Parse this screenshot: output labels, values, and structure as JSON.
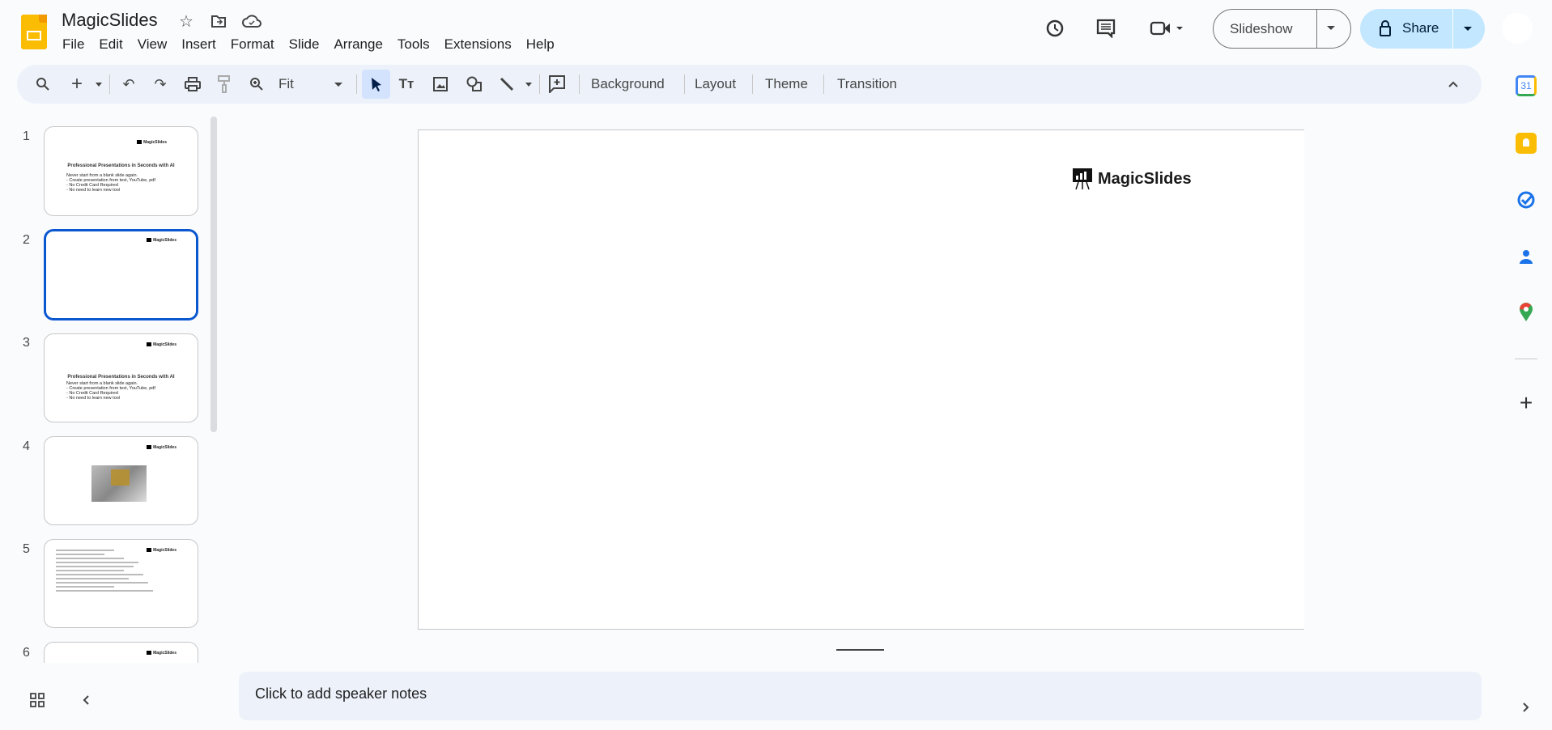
{
  "app": {
    "title": "MagicSlides",
    "menu": [
      "File",
      "Edit",
      "View",
      "Insert",
      "Format",
      "Slide",
      "Arrange",
      "Tools",
      "Extensions",
      "Help"
    ]
  },
  "header": {
    "slideshow_label": "Slideshow",
    "share_label": "Share"
  },
  "toolbar": {
    "zoom_value": "Fit",
    "buttons": [
      "Background",
      "Layout",
      "Theme",
      "Transition"
    ]
  },
  "slides": [
    {
      "number": "1",
      "logo": "MagicSlides",
      "title": "Professional Presentations in Seconds with AI",
      "lines": [
        "Never start from a blank slide again.",
        "- Create presentation from text, YouTube, pdf",
        "- No Credit Card Required",
        "- No need to learn new tool"
      ]
    },
    {
      "number": "2",
      "logo": "MagicSlides"
    },
    {
      "number": "3",
      "logo": "MagicSlides",
      "title": "Professional Presentations in Seconds with AI",
      "lines": [
        "Never start from a blank slide again.",
        "- Create presentation from text, YouTube, pdf",
        "- No Credit Card Required",
        "- No need to learn new tool"
      ]
    },
    {
      "number": "4",
      "logo": "MagicSlides"
    },
    {
      "number": "5",
      "logo": "MagicSlides"
    },
    {
      "number": "6",
      "logo": "MagicSlides"
    }
  ],
  "canvas": {
    "logo": "MagicSlides"
  },
  "notes": {
    "placeholder": "Click to add speaker notes"
  },
  "colors": {
    "accent": "#0b57d0",
    "share_bg": "#c2e7ff",
    "toolbar_bg": "#edf2fa"
  }
}
